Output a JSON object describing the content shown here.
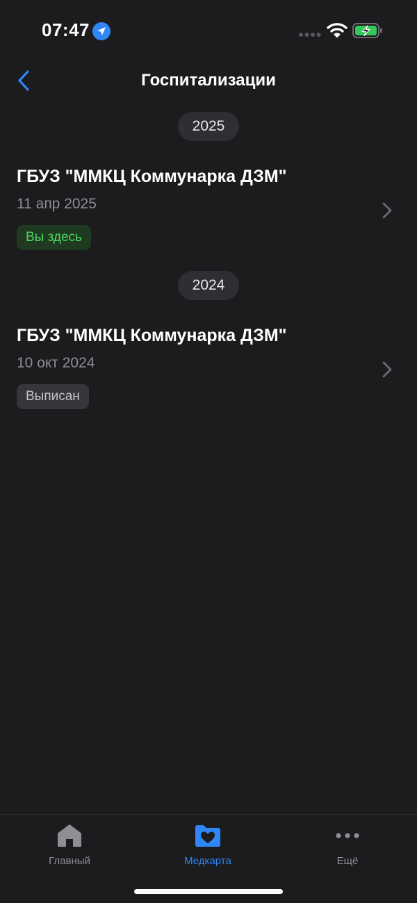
{
  "status_bar": {
    "time": "07:47"
  },
  "nav": {
    "title": "Госпитализации"
  },
  "groups": [
    {
      "year": "2025",
      "items": [
        {
          "name": "ГБУЗ \"ММКЦ Коммунарка ДЗМ\"",
          "date": "11 апр 2025",
          "status": "Вы здесь"
        }
      ]
    },
    {
      "year": "2024",
      "items": [
        {
          "name": "ГБУЗ \"ММКЦ Коммунарка ДЗМ\"",
          "date": "10 окт 2024",
          "status": "Выписан"
        }
      ]
    }
  ],
  "tabs": [
    {
      "label": "Главный",
      "icon": "home-icon",
      "active": false
    },
    {
      "label": "Медкарта",
      "icon": "medcard-folder-heart-icon",
      "active": true
    },
    {
      "label": "Ещё",
      "icon": "more-dots-icon",
      "active": false
    }
  ],
  "colors": {
    "background": "#1c1c1e",
    "accent": "#2f86f6",
    "status_here": "#4cd964",
    "status_here_bg": "#203a22",
    "status_out_bg": "#36373b"
  }
}
